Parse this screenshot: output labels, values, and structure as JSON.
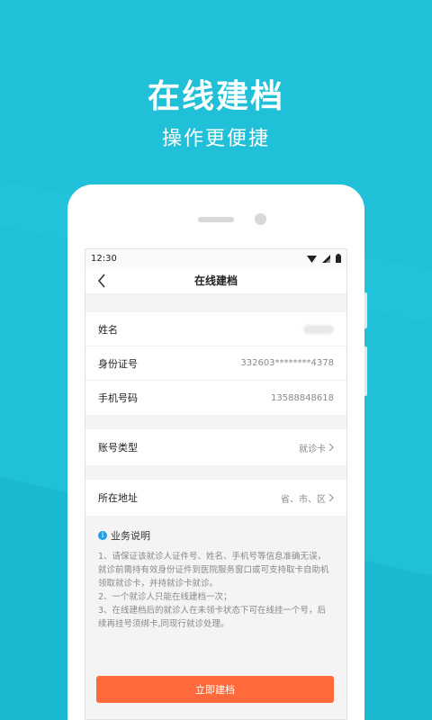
{
  "hero": {
    "title": "在线建档",
    "subtitle": "操作更便捷"
  },
  "status_bar": {
    "time": "12:30",
    "icons": [
      "wifi-icon",
      "signal-icon",
      "battery-icon"
    ]
  },
  "nav": {
    "title": "在线建档",
    "back_icon": "chevron-left-icon"
  },
  "form": {
    "name_label": "姓名",
    "id_label": "身份证号",
    "id_value": "332603********4378",
    "phone_label": "手机号码",
    "phone_value": "13588848618",
    "account_type_label": "账号类型",
    "account_type_value": "就诊卡",
    "address_label": "所在地址",
    "address_value": "省、市、区"
  },
  "notice": {
    "title": "业务说明",
    "lines": [
      "1、请保证该就诊人证件号、姓名、手机号等信息准确无误，就诊前需持有效身份证件到医院服务窗口或可支持取卡自助机领取就诊卡，并持就诊卡就诊。",
      "2、一个就诊人只能在线建档一次；",
      "3、在线建档后的就诊人在未领卡状态下可在线挂一个号，后续再挂号须绑卡,同现行就诊处理。"
    ]
  },
  "submit_label": "立即建档",
  "colors": {
    "background": "#1fc0d8",
    "accent_button": "#ff6a3d",
    "info_icon": "#1fa0e8"
  }
}
